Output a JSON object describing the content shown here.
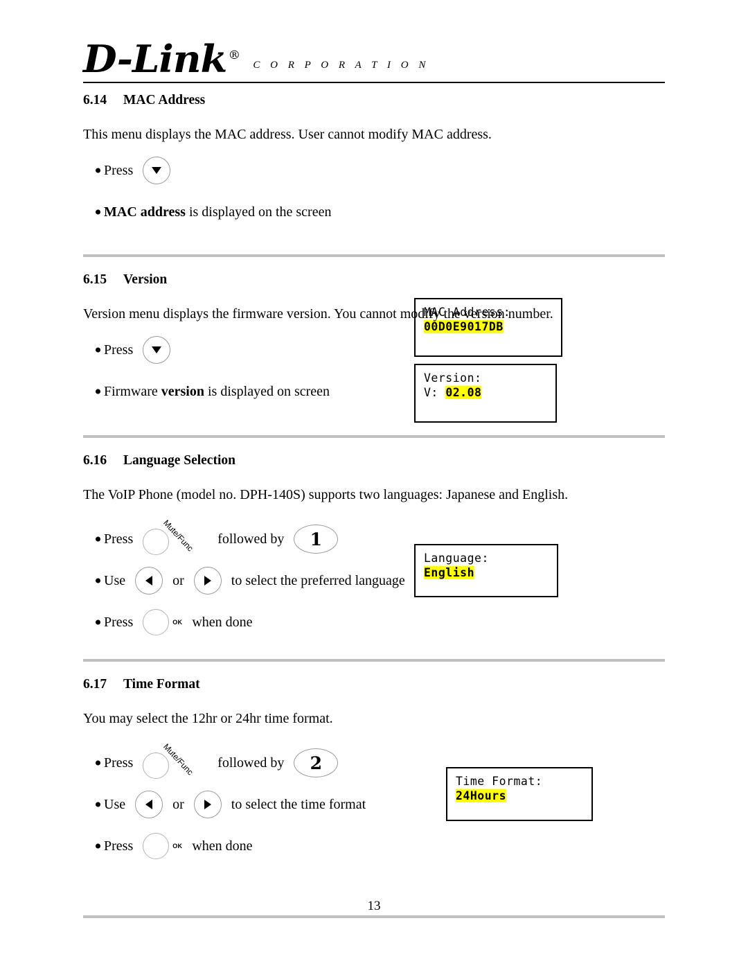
{
  "header": {
    "brand": "D-Link",
    "registered_mark": "®",
    "corporation": "C O R P O R A T I O N"
  },
  "sections": [
    {
      "number": "6.14",
      "title": "MAC Address",
      "intro": "This menu displays the MAC address. User cannot modify MAC address.",
      "steps": [
        {
          "label": "Press",
          "icon": "down-arrow-key"
        },
        {
          "bold_lead": "MAC address",
          "rest": " is displayed on the screen"
        }
      ],
      "lcd": {
        "line1": "MAC Address:",
        "line2_highlight": "00D0E9017DB"
      }
    },
    {
      "number": "6.15",
      "title": "Version",
      "intro": "Version menu displays the firmware version. You cannot modify the version number.",
      "steps": [
        {
          "label": "Press",
          "icon": "down-arrow-key"
        },
        {
          "lead": "Firmware ",
          "bold": "version",
          "rest": " is displayed on screen"
        }
      ],
      "lcd": {
        "line1": "Version:",
        "line2_prefix": "V: ",
        "line2_highlight": "02.08"
      }
    },
    {
      "number": "6.16",
      "title": "Language Selection",
      "intro": "The VoIP Phone (model no. DPH-140S) supports two languages: Japanese and English.",
      "steps": [
        {
          "label": "Press",
          "mutefunc_label": "Mute/Func",
          "middle": "followed by",
          "digit": "1"
        },
        {
          "label": "Use",
          "or": "or",
          "tail": "to select the preferred language"
        },
        {
          "label": "Press",
          "ok_label": "OK",
          "tail": "when done"
        }
      ],
      "lcd": {
        "line1": "Language:",
        "line2_highlight": "English"
      }
    },
    {
      "number": "6.17",
      "title": "Time Format",
      "intro": "You may select the 12hr or 24hr time format.",
      "steps": [
        {
          "label": "Press",
          "mutefunc_label": "Mute/Func",
          "middle": "followed by",
          "digit": "2"
        },
        {
          "label": "Use",
          "or": "or",
          "tail": "to select the time format"
        },
        {
          "label": "Press",
          "ok_label": "OK",
          "tail": "when done"
        }
      ],
      "lcd": {
        "line1": "Time Format:",
        "line2_highlight": "24Hours"
      }
    }
  ],
  "footer": {
    "page_number": "13"
  },
  "colors": {
    "highlight": "#ffff00",
    "separator": "#c0c0c0",
    "text": "#000000"
  }
}
